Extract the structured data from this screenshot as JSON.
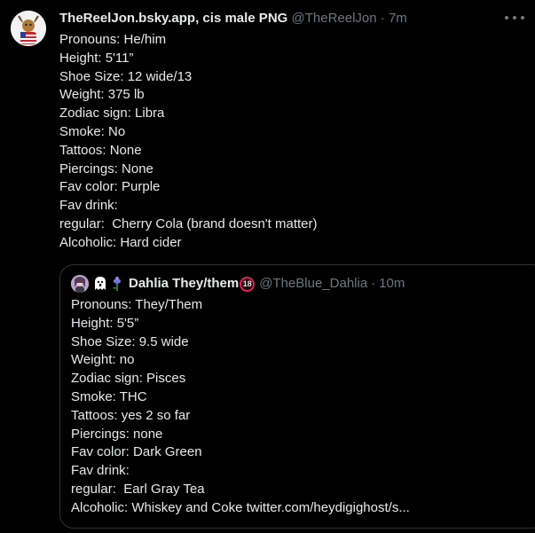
{
  "tweet": {
    "display_name": "TheReelJon.bsky.app, cis male PNG",
    "handle": "@TheReelJon",
    "separator": "·",
    "time": "7m",
    "lines": [
      "Pronouns: He/him",
      "Height: 5'11”",
      "Shoe Size: 12 wide/13",
      "Weight: 375 lb",
      "Zodiac sign: Libra",
      "Smoke: No",
      "Tattoos: None",
      "Piercings: None",
      "Fav color: Purple",
      "Fav drink:",
      "regular:  Cherry Cola (brand doesn't matter)",
      "Alcoholic: Hard cider"
    ]
  },
  "quote": {
    "display_name": "Dahlia They/them",
    "badge": "18",
    "handle": "@TheBlue_Dahlia",
    "separator": "·",
    "time": "10m",
    "lines": [
      "Pronouns: They/Them",
      "Height: 5'5”",
      "Shoe Size: 9.5 wide",
      "Weight: no",
      "Zodiac sign: Pisces",
      "Smoke: THC",
      "Tattoos: yes 2 so far",
      "Piercings: none",
      "Fav color: Dark Green",
      "Fav drink:",
      "regular:  Earl Gray Tea",
      "Alcoholic: Whiskey and Coke twitter.com/heydigighost/s..."
    ]
  },
  "colors": {
    "background": "#000000",
    "primary_text": "#e7e9ea",
    "secondary_text": "#71767b",
    "border": "#2f3336",
    "badge_ring": "#e0245e"
  }
}
